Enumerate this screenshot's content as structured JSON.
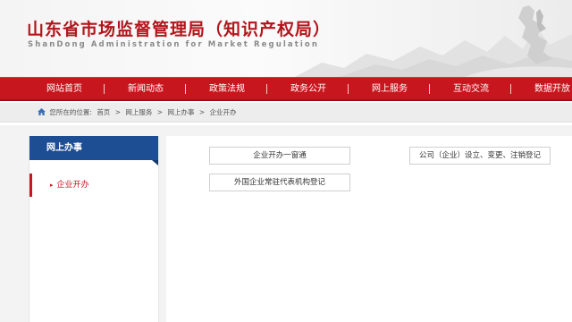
{
  "header": {
    "title": "山东省市场监督管理局（知识产权局）",
    "subtitle": "ShanDong Administration for Market Regulation"
  },
  "nav": {
    "items": [
      {
        "label": "网站首页"
      },
      {
        "label": "新闻动态"
      },
      {
        "label": "政策法规"
      },
      {
        "label": "政务公开"
      },
      {
        "label": "网上服务"
      },
      {
        "label": "互动交流"
      },
      {
        "label": "数据开放"
      }
    ]
  },
  "breadcrumb": {
    "prefix": "您所在的位置:",
    "items": [
      "首页",
      ">",
      "网上服务",
      ">",
      "网上办事",
      ">",
      "企业开办"
    ],
    "icon": "home-icon"
  },
  "sidebar": {
    "heading": "网上办事",
    "items": [
      {
        "label": "企业开办",
        "active": true
      }
    ]
  },
  "services": [
    {
      "label": "企业开办一窗通"
    },
    {
      "label": "公司（企业）设立、变更、注销登记"
    },
    {
      "label": "外国企业常驻代表机构登记"
    }
  ],
  "colors": {
    "brand_red": "#c8161e",
    "nav_blue": "#1d4d92"
  }
}
